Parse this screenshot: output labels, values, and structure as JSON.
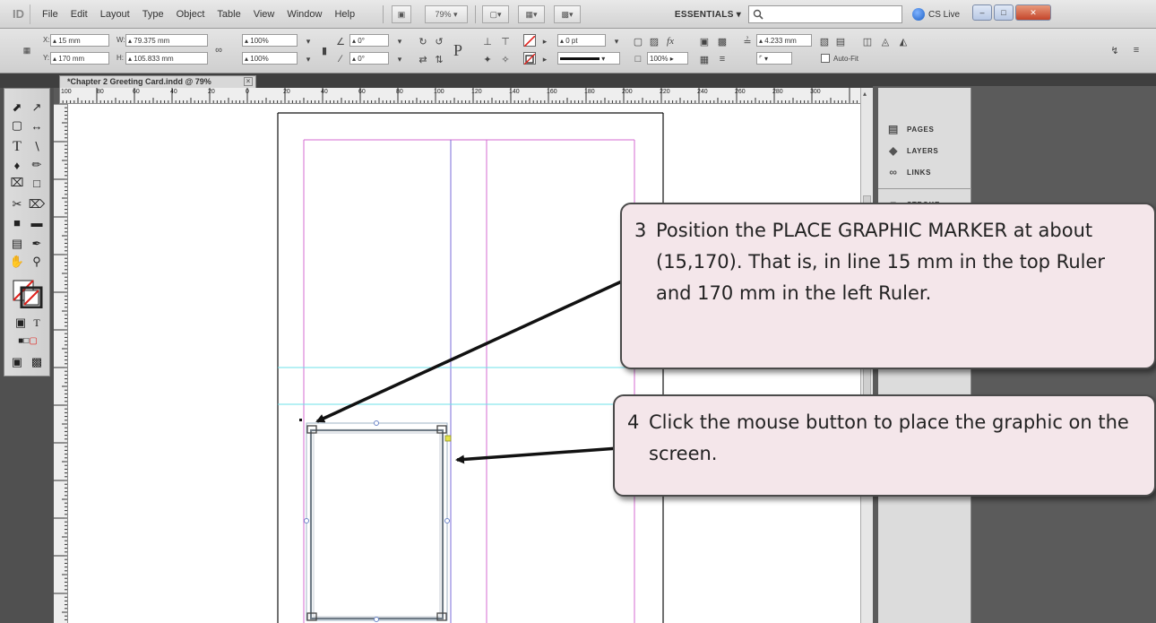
{
  "menubar": {
    "logo": "ID",
    "items": [
      "File",
      "Edit",
      "Layout",
      "Type",
      "Object",
      "Table",
      "View",
      "Window",
      "Help"
    ],
    "zoom": "79%",
    "workspace": "ESSENTIALS",
    "cslive": "CS Live"
  },
  "controlbar": {
    "x_label": "X:",
    "x_value": "15 mm",
    "y_label": "Y:",
    "y_value": "170 mm",
    "w_label": "W:",
    "w_value": "79.375 mm",
    "h_label": "H:",
    "h_value": "105.833 mm",
    "scale_x": "100%",
    "scale_y": "100%",
    "rotate": "0°",
    "shear": "0°",
    "stroke_weight": "0 pt",
    "opacity": "100%",
    "fit_value": "4.233 mm",
    "autofit": "Auto-Fit"
  },
  "document": {
    "tab_title": "*Chapter 2 Greeting Card.indd @ 79%"
  },
  "rulers": {
    "top_labels": [
      "100",
      "80",
      "60",
      "40",
      "20",
      "0",
      "20",
      "40",
      "60",
      "80",
      "100",
      "120",
      "140",
      "160",
      "180",
      "200",
      "220",
      "240",
      "260",
      "280",
      "300"
    ]
  },
  "panels": {
    "items": [
      {
        "label": "PAGES",
        "icon": "pages-icon"
      },
      {
        "label": "LAYERS",
        "icon": "layers-icon"
      },
      {
        "label": "LINKS",
        "icon": "links-icon"
      },
      {
        "label": "STROKE",
        "icon": "stroke-icon"
      }
    ]
  },
  "callouts": [
    {
      "number": "3",
      "text": "Position the PLACE GRAPHIC MARKER at about (15,170). That is, in line 15 mm in the top Ruler and 170 mm in the left Ruler."
    },
    {
      "number": "4",
      "text": "Click the mouse button to place the graphic on the screen."
    }
  ],
  "colors": {
    "callout_bg": "#f4e6ea",
    "margin_guide": "#d46bd0",
    "ruler_guide": "#6ee0ea",
    "frame_stroke": "#7f8e9c"
  }
}
